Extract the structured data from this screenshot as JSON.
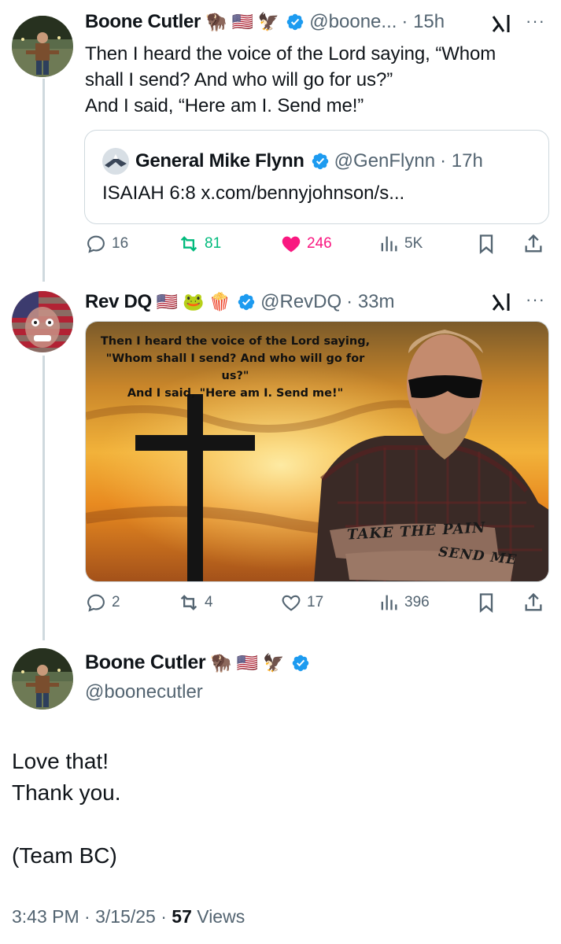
{
  "tweet1": {
    "name": "Boone Cutler",
    "emojis": [
      "🦬",
      "🇺🇸",
      "🦅"
    ],
    "handle": "@boone...",
    "time": "· 15h",
    "text_lines": [
      "Then I heard the voice of the Lord saying, “Whom",
      "shall I send? And who will go for us?”",
      "And I said, “Here am I. Send me!”"
    ],
    "quote": {
      "name": "General Mike Flynn",
      "handle": "@GenFlynn",
      "time": "· 17h",
      "text": "ISAIAH 6:8 x.com/bennyjohnson/s..."
    },
    "actions": {
      "replies": "16",
      "reposts": "81",
      "likes": "246",
      "views": "5K"
    }
  },
  "tweet2": {
    "name": "Rev DQ",
    "emojis": [
      "🇺🇸",
      "🐸",
      "🍿"
    ],
    "handle": "@RevDQ",
    "time": "· 33m",
    "image": {
      "quote_lines": [
        "Then I heard the voice of the Lord saying,",
        "\"Whom shall I send? And who will go for us?\"",
        "And I said, \"Here am I. Send me!\""
      ],
      "tattoo_top": "TAKE THE PAIN",
      "tattoo_bottom": "SEND ME"
    },
    "actions": {
      "replies": "2",
      "reposts": "4",
      "likes": "17",
      "views": "396"
    }
  },
  "main_tweet": {
    "name": "Boone Cutler",
    "emojis": [
      "🦬",
      "🇺🇸",
      "🦅"
    ],
    "handle": "@boonecutler",
    "text_lines": [
      "Love that!",
      "Thank you.",
      "(Team BC)"
    ],
    "timestamp": "3:43 PM · 3/15/25 · ",
    "views_count": "57",
    "views_label": " Views"
  },
  "colors": {
    "verified": "#1d9bf0",
    "like_active": "#f91880",
    "repost_active": "#00ba7c",
    "muted": "#536471"
  }
}
